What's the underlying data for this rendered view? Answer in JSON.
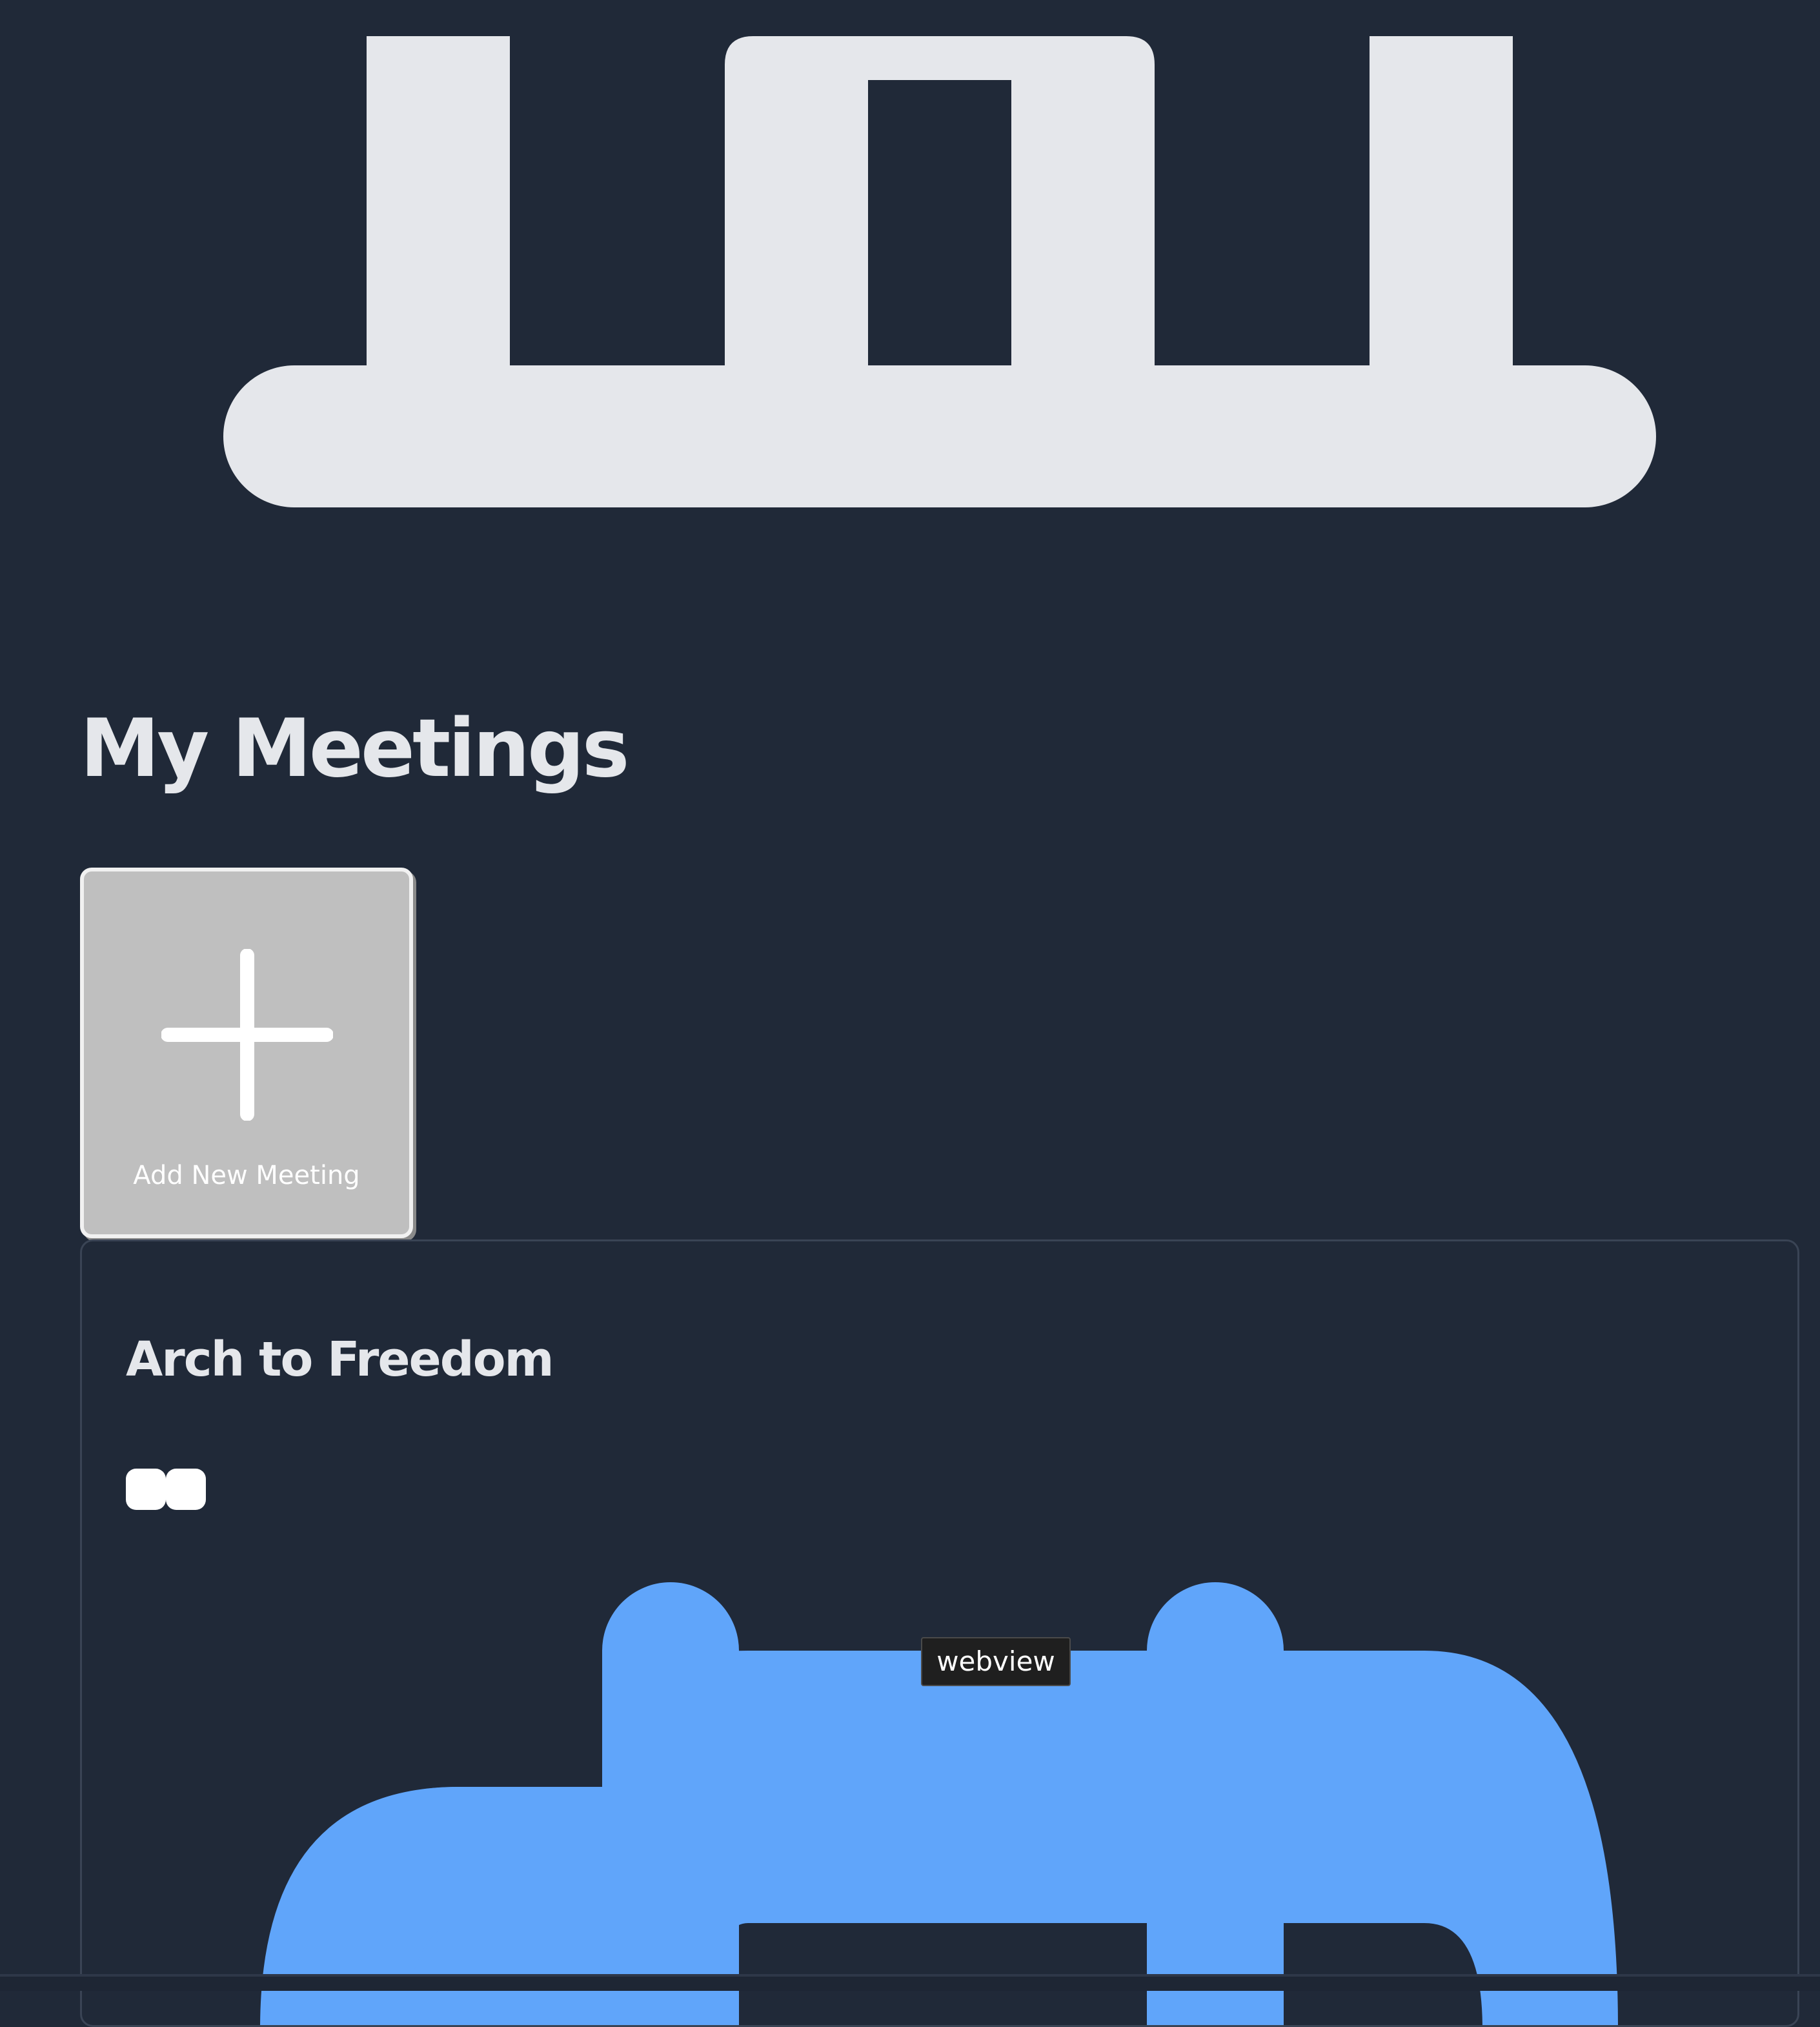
{
  "colors": {
    "background": "#202938",
    "heading_text": "#e5e7eb",
    "top_icon": "#e5e7eb",
    "add_card_background": "#bfbfbf",
    "add_card_border": "#f1f1f1",
    "calendar_icon": "#60a5fa",
    "tooltip_background": "#1f1f1f"
  },
  "header": {
    "icon": "calendar-icon"
  },
  "main": {
    "title": "My Meetings",
    "add_card": {
      "icon": "plus-icon",
      "label": "Add New Meeting"
    },
    "meeting": {
      "title": "Arch to Freedom",
      "icon": "calendar-icon"
    }
  },
  "tooltip": {
    "text": "webview"
  }
}
